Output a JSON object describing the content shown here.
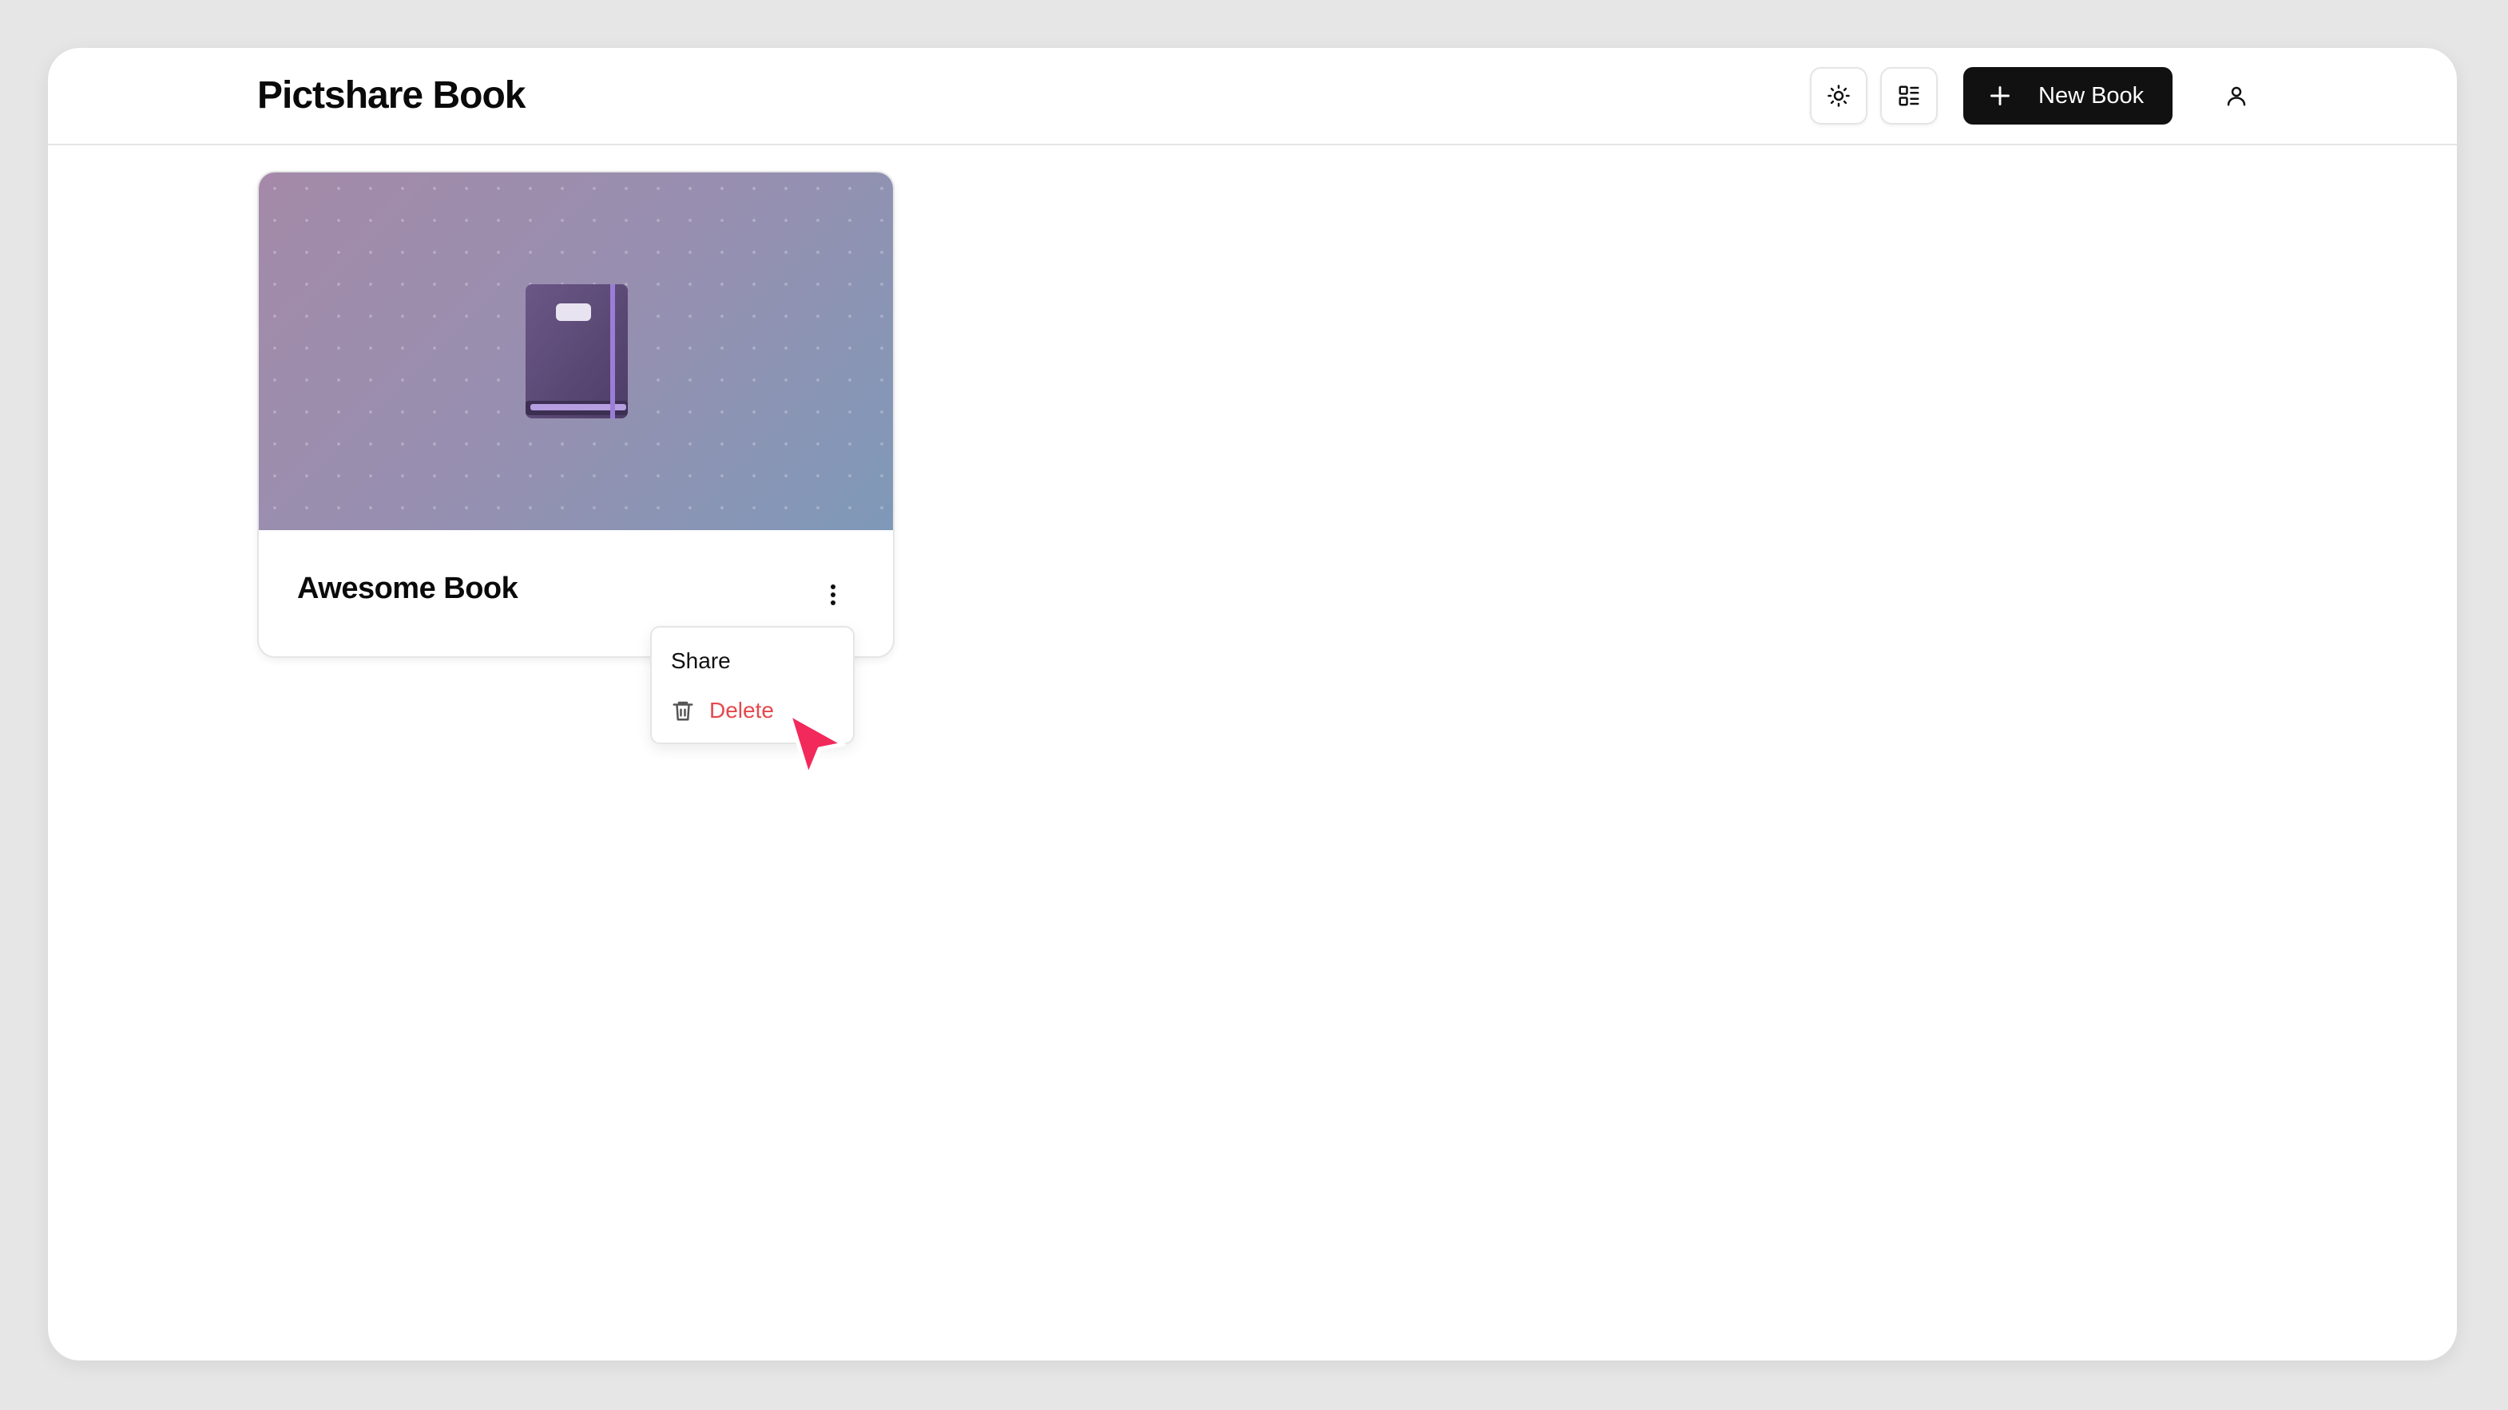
{
  "header": {
    "title": "Pictshare Book",
    "theme_toggle_icon": "sun-icon",
    "layout_toggle_icon": "list-layout-icon",
    "new_book_label": "New Book",
    "new_book_icon": "plus-icon",
    "user_icon": "user-icon"
  },
  "books": [
    {
      "title": "Awesome Book",
      "cover_icon": "notebook-icon",
      "menu_icon": "more-vertical-icon"
    }
  ],
  "context_menu": {
    "items": [
      {
        "label": "Share"
      },
      {
        "label": "Delete",
        "icon": "trash-icon",
        "color": "#e5484d"
      }
    ]
  },
  "colors": {
    "primary_button": "#111111",
    "destructive": "#e5484d",
    "cursor": "#f2295b",
    "cover_gradient_start": "#a48aa8",
    "cover_gradient_end": "#7f99b8"
  }
}
